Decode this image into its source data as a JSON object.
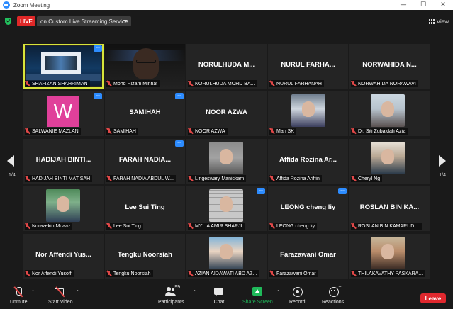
{
  "window": {
    "title": "Zoom Meeting",
    "controls": {
      "minimize": "—",
      "maximize": "☐",
      "close": "✕"
    }
  },
  "topbar": {
    "live_label": "LIVE",
    "live_service": "on Custom Live Streaming Service",
    "view_label": "View"
  },
  "pager": {
    "left": "1/4",
    "right": "1/4"
  },
  "participants": [
    {
      "display": "",
      "label": "SHAFIZAN SHAHRIMAN",
      "media": "screen-share",
      "active": true,
      "more": true
    },
    {
      "display": "",
      "label": "Mohd Rizam Minhat",
      "media": "rizam",
      "more": false
    },
    {
      "display": "NORULHUDA M...",
      "label": "NORULHUDA MOHD BA...",
      "media": "",
      "more": false
    },
    {
      "display": "NURUL FARHA...",
      "label": "NURUL FARHANAH",
      "media": "",
      "more": false
    },
    {
      "display": "NORWAHIDA N...",
      "label": "NORWAHIDA NORAWAVI",
      "media": "",
      "more": false
    },
    {
      "display": "W",
      "label": "SALWANIE MAZLAN",
      "media": "avatar-w",
      "more": true
    },
    {
      "display": "SAMIHAH",
      "label": "SAMIHAH",
      "media": "",
      "more": true
    },
    {
      "display": "NOOR AZWA",
      "label": "NOOR AZWA",
      "media": "",
      "more": false
    },
    {
      "display": "",
      "label": "Mah SK",
      "media": "mahsk",
      "more": false
    },
    {
      "display": "",
      "label": "Dr. Siti Zubaidah Aziz",
      "media": "siti",
      "more": false
    },
    {
      "display": "HADIJAH BINTI...",
      "label": "HADIJAH BINTI MAT SAH",
      "media": "",
      "more": false
    },
    {
      "display": "FARAH NADIA...",
      "label": "FARAH NADIA ABDUL W...",
      "media": "",
      "more": true
    },
    {
      "display": "",
      "label": "Lingeswary Manickam",
      "media": "linges",
      "more": false
    },
    {
      "display": "Affida Rozina Ar...",
      "label": "Affida Rozina Ariffin",
      "media": "",
      "more": false
    },
    {
      "display": "",
      "label": "Cheryl Ng",
      "media": "cheryl",
      "more": false
    },
    {
      "display": "",
      "label": "Norazekin Muaaz",
      "media": "norazekin",
      "more": false
    },
    {
      "display": "Lee Sui Ting",
      "label": "Lee Sui Ting",
      "media": "",
      "more": false
    },
    {
      "display": "",
      "label": "MYLIA AMIR SHARJI",
      "media": "mylia",
      "more": true
    },
    {
      "display": "LEONG cheng liy",
      "label": "LEONG cheng liy",
      "media": "",
      "more": true
    },
    {
      "display": "ROSLAN BIN KA...",
      "label": "ROSLAN BIN KAMARUDI...",
      "media": "",
      "more": false
    },
    {
      "display": "Nor Affendi Yus...",
      "label": "Nor Affendi Yusoff",
      "media": "",
      "more": false
    },
    {
      "display": "Tengku Noorsiah",
      "label": "Tengku Noorsiah",
      "media": "",
      "more": false
    },
    {
      "display": "",
      "label": "AZIAN AIDAWATI ABD AZ...",
      "media": "azian",
      "more": false
    },
    {
      "display": "Farazawani Omar",
      "label": "Farazawani Omar",
      "media": "",
      "more": false
    },
    {
      "display": "",
      "label": "THILAKAVATHY PASKARA...",
      "media": "thila",
      "more": false
    }
  ],
  "toolbar": {
    "unmute": "Unmute",
    "start_video": "Start Video",
    "participants": "Participants",
    "participants_count": "99",
    "chat": "Chat",
    "share_screen": "Share Screen",
    "record": "Record",
    "reactions": "Reactions",
    "leave": "Leave"
  },
  "colors": {
    "accent": "#2d8cff",
    "live": "#e02828",
    "share": "#1fb95a",
    "leave": "#e0282e",
    "active_speaker": "#d7e43a"
  }
}
